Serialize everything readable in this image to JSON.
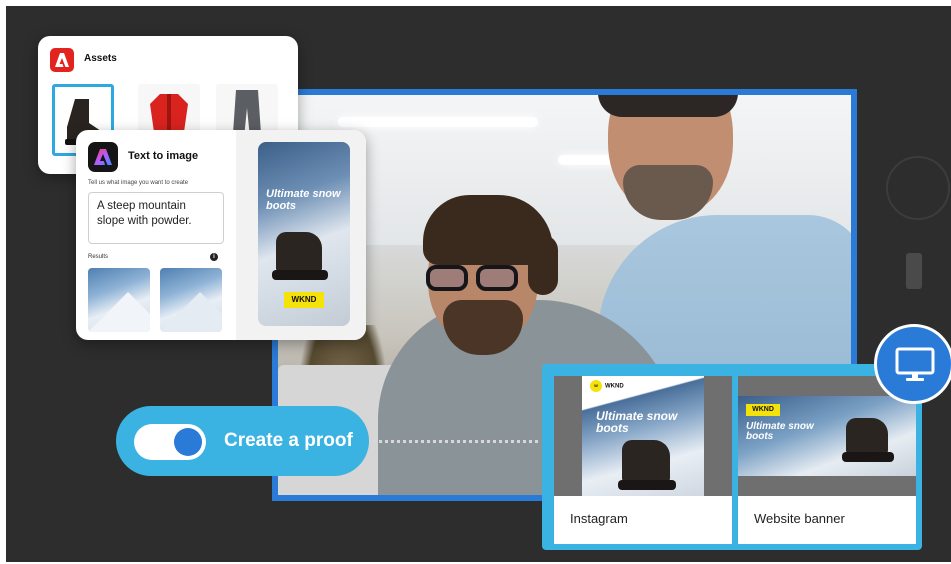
{
  "assets_panel": {
    "title": "Assets"
  },
  "text_to_image": {
    "title": "Text to image",
    "hint": "Tell us what image you want to create",
    "prompt_value": "A steep mountain slope with powder.",
    "results_label": "Results"
  },
  "poster": {
    "headline": "Ultimate snow boots",
    "badge": "WKND"
  },
  "proof_toggle": {
    "label": "Create a proof",
    "state": "on"
  },
  "outputs": [
    {
      "label": "Instagram",
      "brand": "WKND",
      "headline": "Ultimate snow boots"
    },
    {
      "label": "Website banner",
      "badge": "WKND",
      "headline": "Ultimate snow boots"
    }
  ],
  "colors": {
    "stage_bg": "#2d2d2d",
    "accent_blue": "#2a7ad7",
    "light_blue": "#3ab3e3",
    "badge_yellow": "#f5e20a",
    "adobe_red": "#e3231e"
  },
  "icons": {
    "assets_logo": "adobe-logo-icon",
    "firefly_logo": "firefly-logo-icon",
    "info": "info-icon",
    "desktop_device": "desktop-monitor-icon",
    "mobile_device": "phone-icon",
    "tablet_device": "circle-device-icon"
  }
}
